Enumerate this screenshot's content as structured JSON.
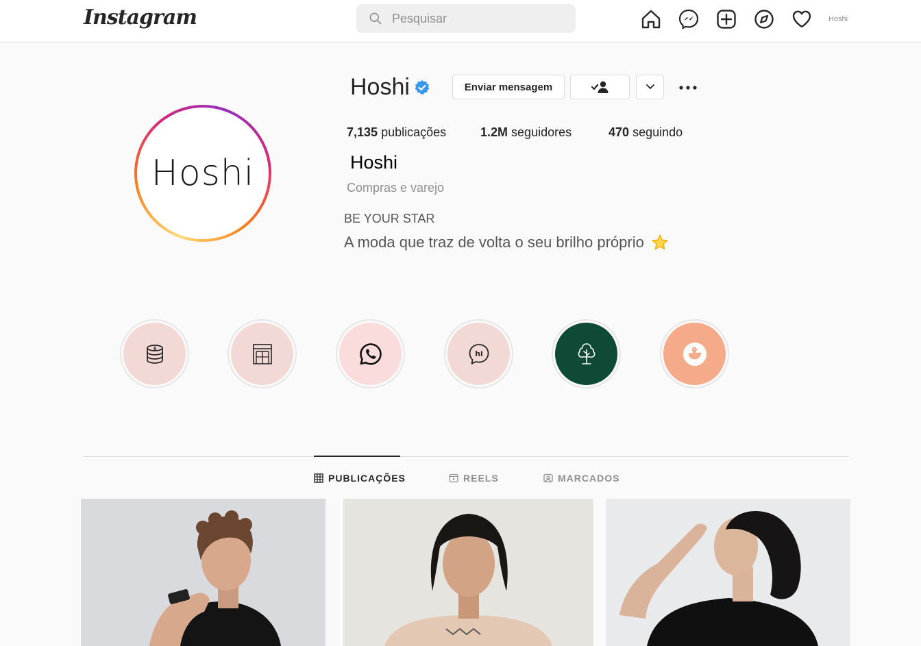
{
  "header": {
    "logo": "Instagram",
    "search_placeholder": "Pesquisar",
    "nav_icons": [
      "home-icon",
      "messenger-icon",
      "new-post-icon",
      "explore-icon",
      "activity-heart-icon"
    ],
    "user_label": "Hoshi"
  },
  "profile": {
    "avatar_text": "Hoshi",
    "username": "Hoshi",
    "verified": true,
    "message_button": "Enviar mensagem",
    "stats": {
      "posts_count": "7,135",
      "posts_label": "publicações",
      "followers_count": "1.2M",
      "followers_label": "seguidores",
      "following_count": "470",
      "following_label": "seguindo"
    },
    "full_name": "Hoshi",
    "category": "Compras e varejo",
    "bio_line1": "BE YOUR STAR",
    "bio_line2": "A moda que traz de volta o seu brilho próprio"
  },
  "highlights": [
    {
      "icon": "coins-icon",
      "bg": "#f2d9d6"
    },
    {
      "icon": "shop-icon",
      "bg": "#f2d9d6"
    },
    {
      "icon": "whatsapp-icon",
      "bg": "#fbdcdc"
    },
    {
      "icon": "hi-chat-icon",
      "bg": "#f2d9d6"
    },
    {
      "icon": "tree-icon",
      "bg": "#0e4a35"
    },
    {
      "icon": "duck-icon",
      "bg": "#f5aa8a"
    }
  ],
  "tabs": [
    {
      "label": "PUBLICAÇÕES",
      "icon": "grid-icon",
      "active": true
    },
    {
      "label": "REELS",
      "icon": "reels-icon",
      "active": false
    },
    {
      "label": "MARCADOS",
      "icon": "tagged-icon",
      "active": false
    }
  ],
  "colors": {
    "verified": "#3897f0",
    "text": "#262626",
    "muted": "#8e8e8e",
    "border": "#dbdbdb"
  }
}
